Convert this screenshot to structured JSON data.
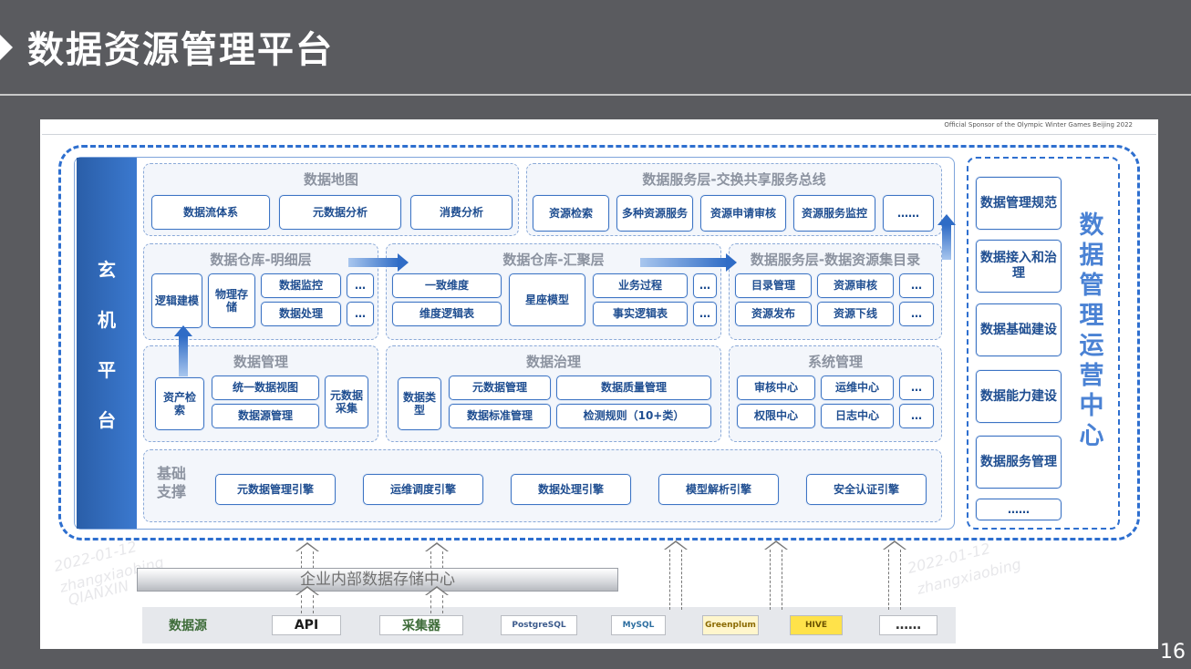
{
  "slide": {
    "title": "数据资源管理平台",
    "page_number": "16"
  },
  "sponsor_text": "Official Sponsor of the Olympic Winter Games Beijing 2022",
  "left_bar": {
    "chars": [
      "玄",
      "机",
      "平",
      "台"
    ]
  },
  "data_map": {
    "title": "数据地图",
    "items": [
      "数据流体系",
      "元数据分析",
      "消费分析"
    ]
  },
  "service_bus": {
    "title": "数据服务层-交换共享服务总线",
    "items": [
      "资源检索",
      "多种资源服务",
      "资源申请审核",
      "资源服务监控",
      "……"
    ]
  },
  "dw_detail": {
    "title": "数据仓库-明细层",
    "items": [
      "逻辑建模",
      "物理存储",
      "数据监控",
      "数据处理",
      "…",
      "…"
    ]
  },
  "dw_summary": {
    "title": "数据仓库-汇聚层",
    "items": [
      "一致维度",
      "维度逻辑表",
      "星座模型",
      "业务过程",
      "事实逻辑表",
      "…",
      "…"
    ]
  },
  "catalog": {
    "title": "数据服务层-数据资源集目录",
    "items": [
      "目录管理",
      "资源审核",
      "资源发布",
      "资源下线",
      "…",
      "…"
    ]
  },
  "data_mgmt": {
    "title": "数据管理",
    "items": [
      "资产检索",
      "统一数据视图",
      "数据源管理",
      "元数据采集"
    ]
  },
  "governance": {
    "title": "数据治理",
    "items": [
      "数据类型",
      "元数据管理",
      "数据质量管理",
      "数据标准管理",
      "检测规则（10+类）"
    ]
  },
  "system_mgmt": {
    "title": "系统管理",
    "items": [
      "审核中心",
      "运维中心",
      "权限中心",
      "日志中心",
      "…",
      "…"
    ]
  },
  "foundation": {
    "title": "基础支撑",
    "items": [
      "元数据管理引擎",
      "运维调度引擎",
      "数据处理引擎",
      "模型解析引擎",
      "安全认证引擎"
    ]
  },
  "ops_center": {
    "vertical_title": [
      "数",
      "据",
      "管",
      "理",
      "运",
      "营",
      "中",
      "心"
    ],
    "items": [
      "数据管理规范",
      "数据接入和治理",
      "数据基础建设",
      "数据能力建设",
      "数据服务管理",
      "……"
    ]
  },
  "storage_center": "企业内部数据存储中心",
  "sources": {
    "label": "数据源",
    "api": "API",
    "collector": "采集器",
    "logos": [
      "PostgreSQL",
      "MySQL",
      "Greenplum",
      "HIVE"
    ],
    "more": "……"
  },
  "watermark": {
    "date": "2022-01-12",
    "user": "zhangxiaobing",
    "org": "QIANXIN"
  }
}
